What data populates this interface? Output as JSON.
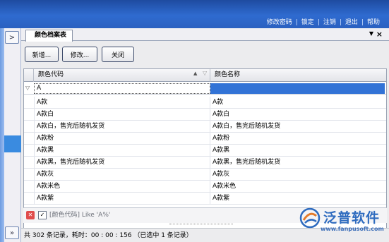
{
  "header": {
    "menu": [
      "修改密码",
      "锁定",
      "注销",
      "退出",
      "帮助"
    ]
  },
  "left_rail": {
    "expand_glyph": ">",
    "collapse_glyph": "»"
  },
  "tab": {
    "title": "颜色档案表",
    "dropdown_glyph": "▼",
    "close_glyph": "×"
  },
  "toolbar": {
    "new_label": "新增...",
    "edit_label": "修改...",
    "close_label": "关闭"
  },
  "grid": {
    "columns": [
      "颜色代码",
      "颜色名称"
    ],
    "filter_value": "A",
    "rows": [
      [
        "A款",
        "A款"
      ],
      [
        "A款白",
        "A款白"
      ],
      [
        "A款白，售完后随机发货",
        "A款白，售完后随机发货"
      ],
      [
        "A款粉",
        "A款粉"
      ],
      [
        "A款黑",
        "A款黑"
      ],
      [
        "A款黑，售完后随机发货",
        "A款黑，售完后随机发货"
      ],
      [
        "A款灰",
        "A款灰"
      ],
      [
        "A款米色",
        "A款米色"
      ],
      [
        "A款紫",
        "A款紫"
      ]
    ]
  },
  "filter_bar": {
    "expression": "[颜色代码] Like 'A%'"
  },
  "status": {
    "text": "共 302 条记录，耗时：00 : 00 : 156 （已选中 1 条记录）"
  },
  "watermark": {
    "name": "泛普软件",
    "url": "www.fanpusoft.com"
  },
  "colors": {
    "header_blue": "#2f6bd0",
    "selection_blue": "#3273d6",
    "watermark_blue": "#2e6bbf"
  }
}
